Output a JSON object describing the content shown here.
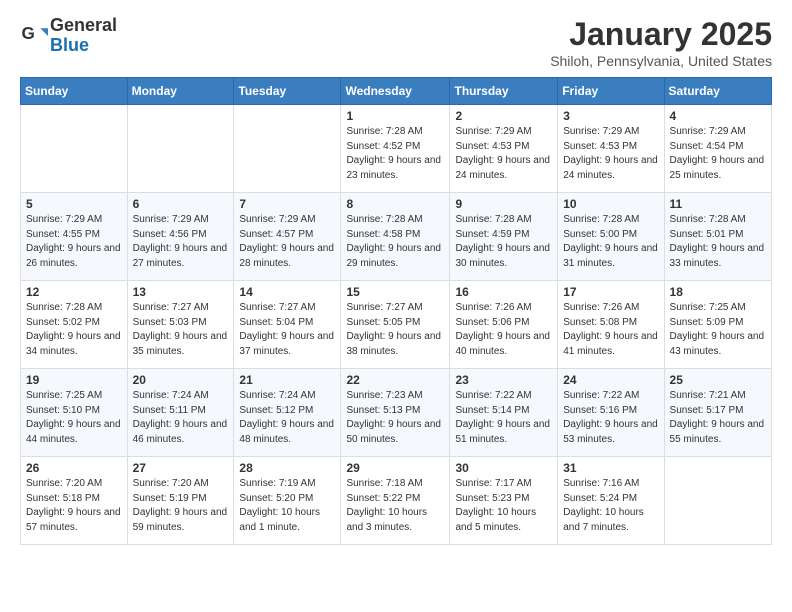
{
  "header": {
    "logo_line1": "General",
    "logo_line2": "Blue",
    "month_title": "January 2025",
    "location": "Shiloh, Pennsylvania, United States"
  },
  "weekdays": [
    "Sunday",
    "Monday",
    "Tuesday",
    "Wednesday",
    "Thursday",
    "Friday",
    "Saturday"
  ],
  "weeks": [
    [
      {
        "day": "",
        "info": ""
      },
      {
        "day": "",
        "info": ""
      },
      {
        "day": "",
        "info": ""
      },
      {
        "day": "1",
        "info": "Sunrise: 7:28 AM\nSunset: 4:52 PM\nDaylight: 9 hours and 23 minutes."
      },
      {
        "day": "2",
        "info": "Sunrise: 7:29 AM\nSunset: 4:53 PM\nDaylight: 9 hours and 24 minutes."
      },
      {
        "day": "3",
        "info": "Sunrise: 7:29 AM\nSunset: 4:53 PM\nDaylight: 9 hours and 24 minutes."
      },
      {
        "day": "4",
        "info": "Sunrise: 7:29 AM\nSunset: 4:54 PM\nDaylight: 9 hours and 25 minutes."
      }
    ],
    [
      {
        "day": "5",
        "info": "Sunrise: 7:29 AM\nSunset: 4:55 PM\nDaylight: 9 hours and 26 minutes."
      },
      {
        "day": "6",
        "info": "Sunrise: 7:29 AM\nSunset: 4:56 PM\nDaylight: 9 hours and 27 minutes."
      },
      {
        "day": "7",
        "info": "Sunrise: 7:29 AM\nSunset: 4:57 PM\nDaylight: 9 hours and 28 minutes."
      },
      {
        "day": "8",
        "info": "Sunrise: 7:28 AM\nSunset: 4:58 PM\nDaylight: 9 hours and 29 minutes."
      },
      {
        "day": "9",
        "info": "Sunrise: 7:28 AM\nSunset: 4:59 PM\nDaylight: 9 hours and 30 minutes."
      },
      {
        "day": "10",
        "info": "Sunrise: 7:28 AM\nSunset: 5:00 PM\nDaylight: 9 hours and 31 minutes."
      },
      {
        "day": "11",
        "info": "Sunrise: 7:28 AM\nSunset: 5:01 PM\nDaylight: 9 hours and 33 minutes."
      }
    ],
    [
      {
        "day": "12",
        "info": "Sunrise: 7:28 AM\nSunset: 5:02 PM\nDaylight: 9 hours and 34 minutes."
      },
      {
        "day": "13",
        "info": "Sunrise: 7:27 AM\nSunset: 5:03 PM\nDaylight: 9 hours and 35 minutes."
      },
      {
        "day": "14",
        "info": "Sunrise: 7:27 AM\nSunset: 5:04 PM\nDaylight: 9 hours and 37 minutes."
      },
      {
        "day": "15",
        "info": "Sunrise: 7:27 AM\nSunset: 5:05 PM\nDaylight: 9 hours and 38 minutes."
      },
      {
        "day": "16",
        "info": "Sunrise: 7:26 AM\nSunset: 5:06 PM\nDaylight: 9 hours and 40 minutes."
      },
      {
        "day": "17",
        "info": "Sunrise: 7:26 AM\nSunset: 5:08 PM\nDaylight: 9 hours and 41 minutes."
      },
      {
        "day": "18",
        "info": "Sunrise: 7:25 AM\nSunset: 5:09 PM\nDaylight: 9 hours and 43 minutes."
      }
    ],
    [
      {
        "day": "19",
        "info": "Sunrise: 7:25 AM\nSunset: 5:10 PM\nDaylight: 9 hours and 44 minutes."
      },
      {
        "day": "20",
        "info": "Sunrise: 7:24 AM\nSunset: 5:11 PM\nDaylight: 9 hours and 46 minutes."
      },
      {
        "day": "21",
        "info": "Sunrise: 7:24 AM\nSunset: 5:12 PM\nDaylight: 9 hours and 48 minutes."
      },
      {
        "day": "22",
        "info": "Sunrise: 7:23 AM\nSunset: 5:13 PM\nDaylight: 9 hours and 50 minutes."
      },
      {
        "day": "23",
        "info": "Sunrise: 7:22 AM\nSunset: 5:14 PM\nDaylight: 9 hours and 51 minutes."
      },
      {
        "day": "24",
        "info": "Sunrise: 7:22 AM\nSunset: 5:16 PM\nDaylight: 9 hours and 53 minutes."
      },
      {
        "day": "25",
        "info": "Sunrise: 7:21 AM\nSunset: 5:17 PM\nDaylight: 9 hours and 55 minutes."
      }
    ],
    [
      {
        "day": "26",
        "info": "Sunrise: 7:20 AM\nSunset: 5:18 PM\nDaylight: 9 hours and 57 minutes."
      },
      {
        "day": "27",
        "info": "Sunrise: 7:20 AM\nSunset: 5:19 PM\nDaylight: 9 hours and 59 minutes."
      },
      {
        "day": "28",
        "info": "Sunrise: 7:19 AM\nSunset: 5:20 PM\nDaylight: 10 hours and 1 minute."
      },
      {
        "day": "29",
        "info": "Sunrise: 7:18 AM\nSunset: 5:22 PM\nDaylight: 10 hours and 3 minutes."
      },
      {
        "day": "30",
        "info": "Sunrise: 7:17 AM\nSunset: 5:23 PM\nDaylight: 10 hours and 5 minutes."
      },
      {
        "day": "31",
        "info": "Sunrise: 7:16 AM\nSunset: 5:24 PM\nDaylight: 10 hours and 7 minutes."
      },
      {
        "day": "",
        "info": ""
      }
    ]
  ]
}
